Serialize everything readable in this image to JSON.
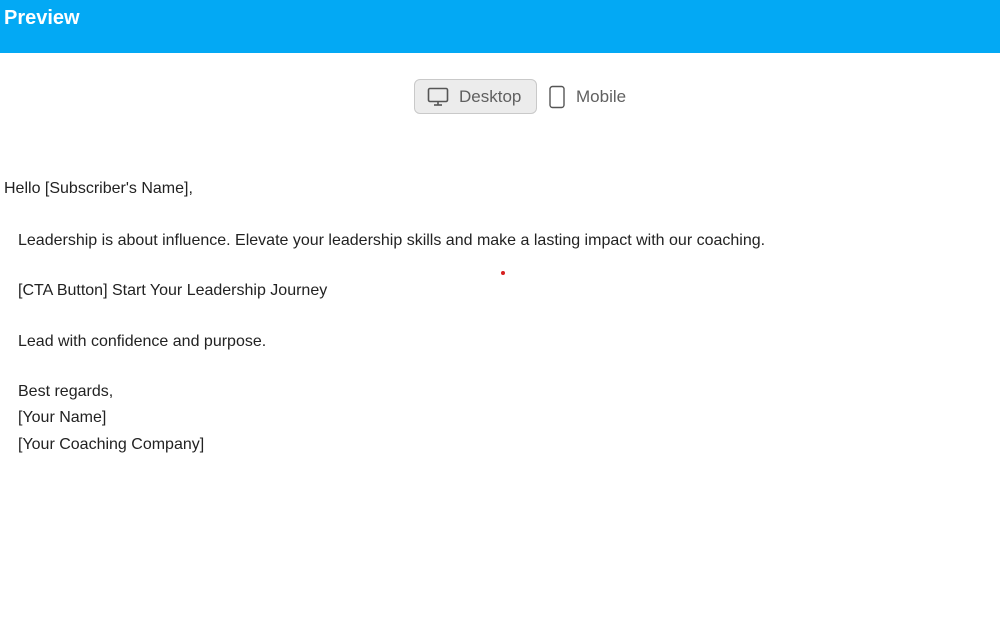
{
  "header": {
    "title": "Preview"
  },
  "view_toggle": {
    "desktop_label": "Desktop",
    "mobile_label": "Mobile",
    "selected": "Desktop",
    "desktop_icon": "monitor-icon",
    "mobile_icon": "phone-icon"
  },
  "email": {
    "greeting": "Hello [Subscriber's Name],",
    "body": "Leadership is about influence. Elevate your leadership skills and make a lasting impact with our coaching.",
    "cta": "[CTA Button] Start Your Leadership Journey",
    "closing_line": "Lead with confidence and purpose.",
    "signoff": "Best regards,",
    "sender_name": "[Your Name]",
    "sender_company": "[Your Coaching Company]"
  },
  "colors": {
    "header_bg": "#03a9f4",
    "header_text": "#ffffff",
    "toggle_selected_bg": "#ececec",
    "marker_dot": "#d62020"
  }
}
